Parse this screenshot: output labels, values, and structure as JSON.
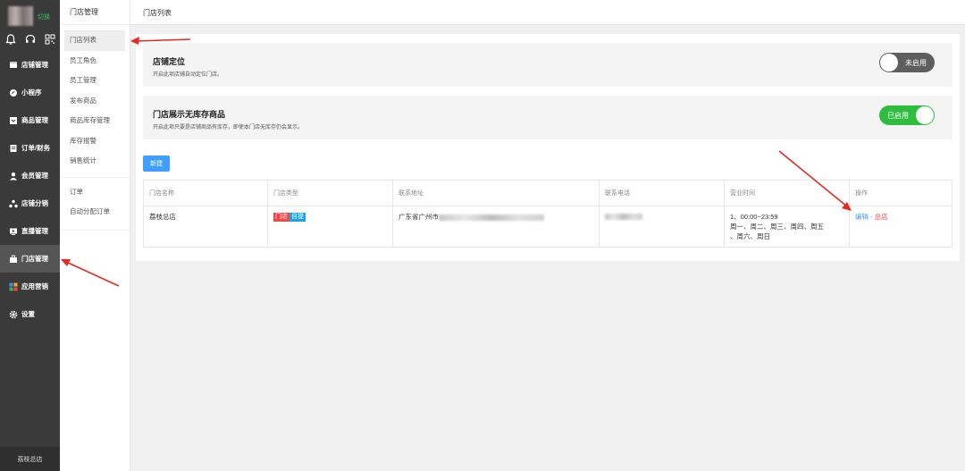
{
  "sidebar": {
    "switch_label": "切换",
    "items": [
      {
        "label": "店铺管理",
        "icon": "store-icon"
      },
      {
        "label": "小程序",
        "icon": "mini-program-icon"
      },
      {
        "label": "商品管理",
        "icon": "goods-icon"
      },
      {
        "label": "订单/财务",
        "icon": "order-icon"
      },
      {
        "label": "会员管理",
        "icon": "member-icon"
      },
      {
        "label": "店铺分销",
        "icon": "distribution-icon"
      },
      {
        "label": "直播管理",
        "icon": "live-icon"
      },
      {
        "label": "门店管理",
        "icon": "shop-icon"
      },
      {
        "label": "应用营销",
        "icon": "apps-icon"
      },
      {
        "label": "设置",
        "icon": "gear-icon"
      }
    ],
    "footer": "荔枝总店"
  },
  "submenu": {
    "title": "门店管理",
    "items": [
      "门店列表",
      "员工角色",
      "员工管理",
      "发布商品",
      "商品库存管理",
      "库存报警",
      "销售统计"
    ],
    "items2": [
      "订单",
      "自动分配订单"
    ]
  },
  "breadcrumb": "门店列表",
  "settings": [
    {
      "title": "店铺定位",
      "desc": "开启此项店铺自动定位门店。",
      "state": "未启用"
    },
    {
      "title": "门店展示无库存商品",
      "desc": "开启此项只要是店铺商品有库存，即使本门店无库存仍会显示。",
      "state": "已启用"
    }
  ],
  "new_button": "新建",
  "table": {
    "headers": [
      "门店名称",
      "门店类型",
      "联系地址",
      "联系电话",
      "营业时间",
      "操作"
    ],
    "row": {
      "name": "荔枝总店",
      "type_tags": [
        "门店",
        "自提"
      ],
      "address_prefix": "广东省广州市",
      "hours_line1": "1、00:00~23:59",
      "hours_line2": "周一、周二、周三、周四、周五",
      "hours_line3": "、周六、周日",
      "action_edit": "编辑",
      "action_sep": " - ",
      "action_main": "总店"
    }
  },
  "colors": {
    "accent": "#409eff",
    "toggle_on": "#2ebd3e",
    "toggle_off": "#5e5e5e",
    "danger": "#f04848"
  }
}
